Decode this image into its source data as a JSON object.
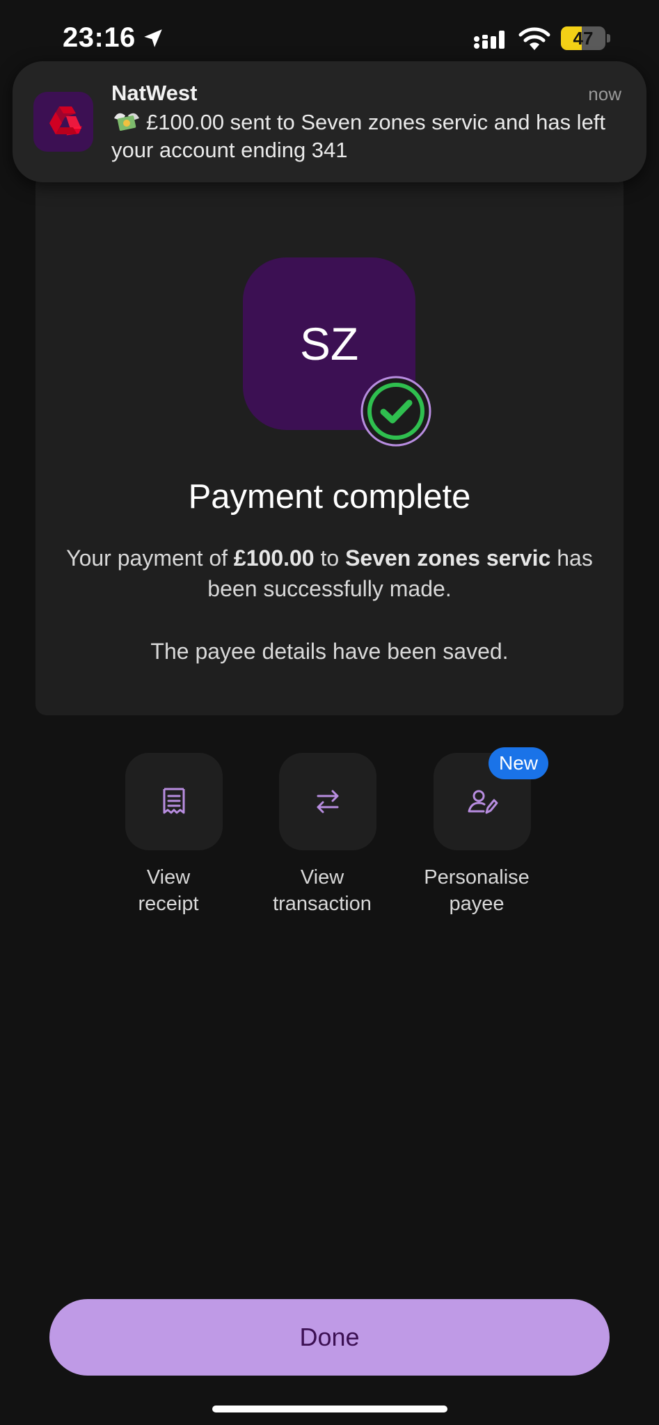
{
  "status_bar": {
    "time": "23:16",
    "battery_level": "47",
    "battery_fraction": 0.47
  },
  "notification": {
    "app_name": "NatWest",
    "time": "now",
    "message": "£100.00 sent to Seven zones servic and has left your account ending 341"
  },
  "payment": {
    "avatar_initials": "SZ",
    "title": "Payment complete",
    "desc_prefix": "Your payment of ",
    "amount": "£100.00",
    "desc_to": " to ",
    "payee": "Seven zones servic",
    "desc_suffix": " has been successfully made.",
    "saved_note": "The payee details have been saved."
  },
  "actions": [
    {
      "label_line1": "View",
      "label_line2": "receipt",
      "icon": "receipt-icon"
    },
    {
      "label_line1": "View",
      "label_line2": "transaction",
      "icon": "swap-arrows-icon"
    },
    {
      "label_line1": "Personalise",
      "label_line2": "payee",
      "icon": "user-edit-icon",
      "badge": "New"
    }
  ],
  "done_label": "Done",
  "colors": {
    "background": "#121212",
    "card": "#1f1f1f",
    "brand_purple": "#3c1053",
    "accent_lilac": "#bf9ae6",
    "success_green": "#2fbf4f",
    "badge_blue": "#1a73e8"
  }
}
